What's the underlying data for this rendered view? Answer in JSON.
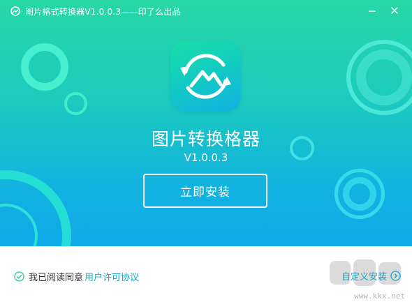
{
  "window": {
    "title": "图片格式转换器V1.0.0.3——印了么出品",
    "accent_color": "#12a8c8",
    "gradient_top": "#27d7a6",
    "gradient_bottom": "#0fa9ea"
  },
  "titlebar": {
    "icon": "app-refresh-icon",
    "minimize_icon": "minimize-icon",
    "close_icon": "close-icon"
  },
  "hero": {
    "logo_icon": "image-convert-icon",
    "app_name": "图片转换格器",
    "version": "V1.0.0.3",
    "install_label": "立即安装"
  },
  "footer": {
    "agree_text": "我已阅读同意",
    "license_link": "用户许可协议",
    "custom_install": "自定义安装",
    "checkbox_checked": true,
    "watermark_url": "www.kkx.net"
  }
}
